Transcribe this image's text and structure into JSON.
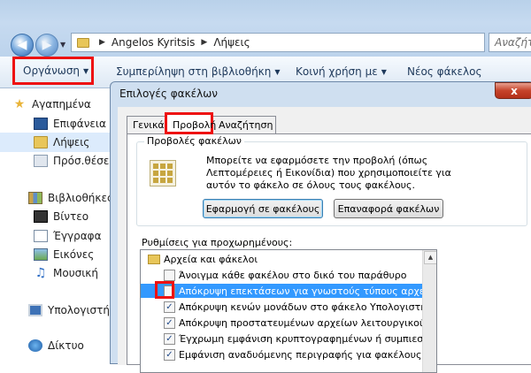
{
  "explorer": {
    "breadcrumb": [
      "Angelos Kyritsis",
      "Λήψεις"
    ],
    "search_placeholder": "Αναζήτ",
    "toolbar": {
      "organize": "Οργάνωση",
      "include_library": "Συμπερίληψη στη βιβλιοθήκη",
      "share_with": "Κοινή χρήση με",
      "new_folder": "Νέος φάκελος"
    },
    "sidebar": [
      {
        "label": "Αγαπημένα",
        "icon": "star-icon"
      },
      {
        "label": "Επιφάνεια ε",
        "icon": "desktop-icon"
      },
      {
        "label": "Λήψεις",
        "icon": "downloads-folder-icon"
      },
      {
        "label": "Πρόσ.θέσεις",
        "icon": "recent-places-icon"
      },
      {
        "label": "Βιβλιοθήκες",
        "icon": "libraries-icon"
      },
      {
        "label": "Βίντεο",
        "icon": "videos-icon"
      },
      {
        "label": "Έγγραφα",
        "icon": "documents-icon"
      },
      {
        "label": "Εικόνες",
        "icon": "pictures-icon"
      },
      {
        "label": "Μουσική",
        "icon": "music-icon"
      },
      {
        "label": "Υπολογιστής",
        "icon": "computer-icon"
      },
      {
        "label": "Δίκτυο",
        "icon": "network-icon"
      }
    ]
  },
  "dialog": {
    "title": "Επιλογές φακέλων",
    "close": "x",
    "tabs": [
      "Γενικά",
      "Προβολή",
      "Αναζήτηση"
    ],
    "folder_views": {
      "label": "Προβολές φακέλων",
      "description": "Μπορείτε να εφαρμόσετε την προβολή (όπως Λεπτομέρειες ή Εικονίδια) που χρησιμοποιείτε για αυτόν το φάκελο σε όλους τους φακέλους.",
      "apply_button": "Εφαρμογή σε φακέλους",
      "reset_button": "Επαναφορά φακέλων"
    },
    "advanced_label": "Ρυθμίσεις για προχωρημένους:",
    "settings": [
      {
        "label": "Αρχεία και φάκελοι",
        "type": "folder",
        "checked": false
      },
      {
        "label": "Άνοιγμα κάθε φακέλου στο δικό του παράθυρο",
        "type": "checkbox",
        "checked": false
      },
      {
        "label": "Απόκρυψη επεκτάσεων για γνωστούς τύπους αρχείων",
        "type": "checkbox",
        "checked": false
      },
      {
        "label": "Απόκρυψη κενών μονάδων στο φάκελο Υπολογιστής",
        "type": "checkbox",
        "checked": true
      },
      {
        "label": "Απόκρυψη προστατευμένων αρχείων λειτουργικού συ",
        "type": "checkbox",
        "checked": true
      },
      {
        "label": "Έγχρωμη εμφάνιση κρυπτογραφημένων ή συμπιεσμέν",
        "type": "checkbox",
        "checked": true
      },
      {
        "label": "Εμφάνιση αναδυόμενης περιγραφής για φακέλους κα",
        "type": "checkbox",
        "checked": true
      }
    ]
  }
}
